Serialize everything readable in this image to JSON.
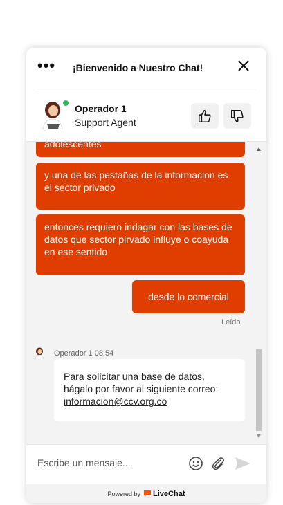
{
  "header": {
    "menu_label": "•••",
    "title": "¡Bienvenido a Nuestro Chat!"
  },
  "agent": {
    "name": "Operador 1",
    "role": "Support Agent",
    "status": "online",
    "status_color": "#2db45c"
  },
  "messages": [
    {
      "from": "visitor",
      "text": "adolescentes"
    },
    {
      "from": "visitor",
      "text": "y una de las pestañas de la informacion es el sector privado"
    },
    {
      "from": "visitor",
      "text": "entonces requiero indagar con las bases de datos que sector pirvado influye o coayuda en ese sentido"
    },
    {
      "from": "visitor",
      "text": "desde lo comercial"
    }
  ],
  "read_label": "Leído",
  "agent_message": {
    "meta": "Operador 1 08:54",
    "text": "Para solicitar una base de datos, hágalo por favor al siguiente correo: ",
    "link": "informacion@ccv.org.co"
  },
  "composer": {
    "placeholder": "Escribe un mensaje..."
  },
  "footer": {
    "powered_by": "Powered by",
    "brand": "LiveChat"
  },
  "colors": {
    "accent": "#e03d00",
    "brand": "#ff5100"
  },
  "icons": [
    "menu-icon",
    "close-icon",
    "thumbs-up-icon",
    "thumbs-down-icon",
    "emoji-icon",
    "attachment-icon",
    "send-icon",
    "livechat-logo-icon"
  ]
}
